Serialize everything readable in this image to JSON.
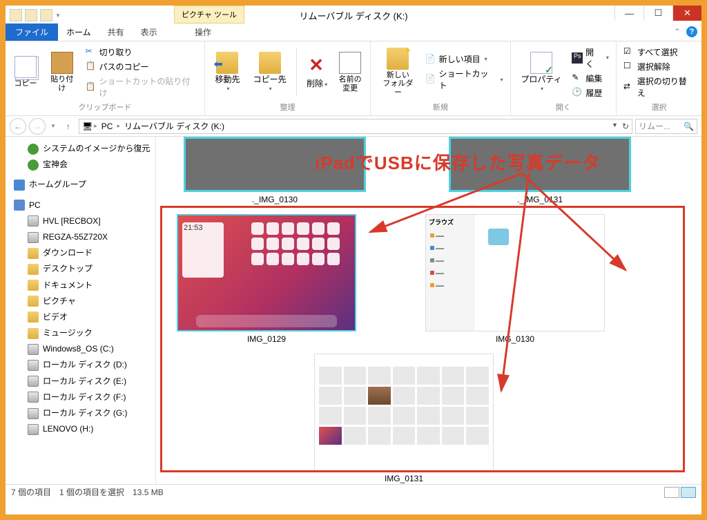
{
  "titlebar": {
    "contextTab": "ピクチャ ツール",
    "title": "リムーバブル ディスク (K:)"
  },
  "tabs": {
    "file": "ファイル",
    "home": "ホーム",
    "share": "共有",
    "view": "表示",
    "context": "操作"
  },
  "ribbon": {
    "clipboard": {
      "copy": "コピー",
      "paste": "貼り付け",
      "cut": "切り取り",
      "copyPath": "パスのコピー",
      "pasteShortcut": "ショートカットの貼り付け",
      "groupLabel": "クリップボード"
    },
    "organize": {
      "moveTo": "移動先",
      "copyTo": "コピー先",
      "delete": "削除",
      "rename": "名前の\n変更",
      "groupLabel": "整理"
    },
    "new": {
      "newFolder": "新しい\nフォルダー",
      "newItem": "新しい項目",
      "shortcut": "ショートカット",
      "groupLabel": "新規"
    },
    "open": {
      "properties": "プロパティ",
      "open": "開く",
      "edit": "編集",
      "history": "履歴",
      "groupLabel": "開く"
    },
    "select": {
      "selectAll": "すべて選択",
      "selectNone": "選択解除",
      "invert": "選択の切り替え",
      "groupLabel": "選択"
    }
  },
  "breadcrumb": {
    "pc": "PC",
    "drive": "リムーバブル ディスク (K:)"
  },
  "search": {
    "placeholder": "リムー..."
  },
  "nav": {
    "systemRestore": "システムのイメージから復元",
    "hojinkai": "宝神会",
    "homegroup": "ホームグループ",
    "pc": "PC",
    "items": [
      {
        "label": "HVL [RECBOX]",
        "icon": "drive"
      },
      {
        "label": "REGZA-55Z720X",
        "icon": "drive"
      },
      {
        "label": "ダウンロード",
        "icon": "folder"
      },
      {
        "label": "デスクトップ",
        "icon": "folder"
      },
      {
        "label": "ドキュメント",
        "icon": "folder"
      },
      {
        "label": "ピクチャ",
        "icon": "folder"
      },
      {
        "label": "ビデオ",
        "icon": "folder"
      },
      {
        "label": "ミュージック",
        "icon": "folder"
      },
      {
        "label": "Windows8_OS (C:)",
        "icon": "drive"
      },
      {
        "label": "ローカル ディスク (D:)",
        "icon": "drive"
      },
      {
        "label": "ローカル ディスク (E:)",
        "icon": "drive"
      },
      {
        "label": "ローカル ディスク (F:)",
        "icon": "drive"
      },
      {
        "label": "ローカル ディスク (G:)",
        "icon": "drive"
      },
      {
        "label": "LENOVO (H:)",
        "icon": "drive"
      }
    ]
  },
  "files": {
    "top1": "._IMG_0130",
    "top2": "._IMG_0131",
    "img0129": "IMG_0129",
    "img0130": "IMG_0130",
    "img0131": "IMG_0131",
    "ipadTime": "21:53",
    "browseLabel": "ブラウズ"
  },
  "annotation": "iPadでUSBに保存した写真データ",
  "status": {
    "count": "7 個の項目",
    "selected": "1 個の項目を選択",
    "size": "13.5 MB"
  }
}
